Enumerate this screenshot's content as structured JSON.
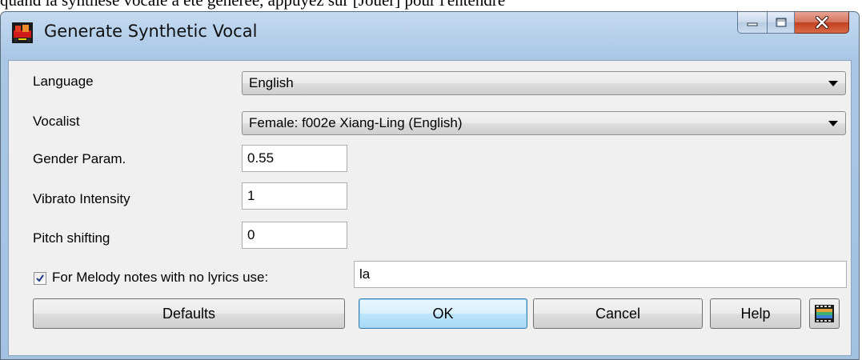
{
  "caption_above": "quand la synthèse vocale a été générée, appuyez sur [Jouer] pour l'entendre",
  "window": {
    "title": "Generate Synthetic Vocal",
    "app_icon": "band-in-a-box-app-icon",
    "controls": [
      "minimize-icon",
      "maximize-icon",
      "close-icon"
    ]
  },
  "form": {
    "language": {
      "label": "Language",
      "value": "English"
    },
    "vocalist": {
      "label": "Vocalist",
      "value": "Female: f002e  Xiang-Ling (English)"
    },
    "gender": {
      "label": "Gender Param.",
      "value": "0.55"
    },
    "vibrato": {
      "label": "Vibrato Intensity",
      "value": "1"
    },
    "pitch": {
      "label": "Pitch shifting",
      "value": "0"
    },
    "melody": {
      "label": "For Melody notes with no lyrics use:",
      "checked": true,
      "value": "la"
    }
  },
  "buttons": {
    "defaults": "Defaults",
    "ok": "OK",
    "cancel": "Cancel",
    "help": "Help",
    "extra_icon": "film-strip-icon"
  },
  "colors": {
    "title_bar": "#b2cde9",
    "close_button": "#c2401f",
    "dialog_bg": "#f0f0f0",
    "default_button": "#bee6fd"
  }
}
